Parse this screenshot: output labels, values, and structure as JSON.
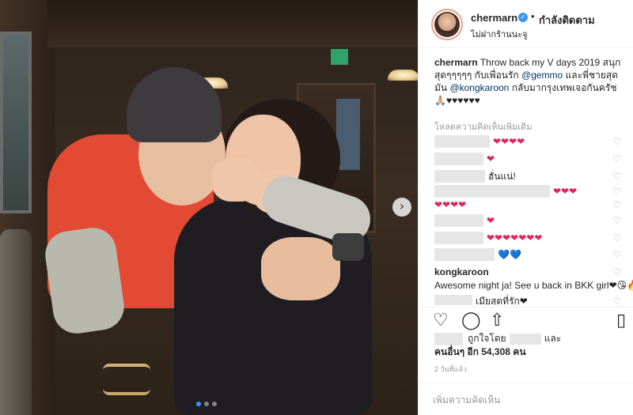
{
  "post": {
    "username": "chermarn",
    "follow_label": "กำลังติดตาม",
    "separator": "•",
    "location": "ไม่ฝากร้านนะจู",
    "next_icon": "chevron-right-icon",
    "carousel_dots": 3
  },
  "caption": {
    "username": "chermarn",
    "part1": "Throw back my V days 2019 สนุกสุดๆๆๆๆๆ กับเพื่อนรัก ",
    "mention1": "@gemmo",
    "part2": " และพี่ชายสุดมัน ",
    "mention2": "@kongkaroon",
    "part3": " กลับมากรุงเทพเจอกันครัช 🙏🏼♥♥♥♥♥♥"
  },
  "load_more": "โหลดความคิดเห็นเพิ่มเติม",
  "comments": [
    {
      "text": "❤❤❤❤"
    },
    {
      "text": "❤"
    },
    {
      "text": "ฮั่นแน่!"
    },
    {
      "text": "❤❤❤"
    },
    {
      "text": "❤❤❤❤"
    },
    {
      "text": "❤"
    },
    {
      "text": "❤❤❤❤❤❤❤"
    },
    {
      "text": "💙💙"
    }
  ],
  "kong_comment": {
    "username": "kongkaroon",
    "text": "Awesome night ja! See u back in BKK girl❤😘🔥!!!"
  },
  "last_comment": {
    "text": "เมียสุดที่รัก❤"
  },
  "likes": {
    "liked_by": "ถูกใจโดย",
    "and": "และ",
    "others_prefix": "คนอื่นๆ อีก",
    "others_count": "54,308",
    "others_suffix": "คน"
  },
  "time_ago": "2 วันที่แล้ว",
  "comment_placeholder": "เพิ่มความคิดเห็น"
}
